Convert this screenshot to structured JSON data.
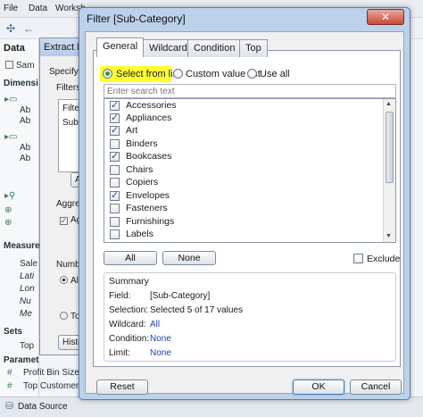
{
  "app": {
    "menu": [
      "File",
      "Data",
      "Worksh"
    ],
    "left_pane": {
      "data_header": "Data",
      "sample_label": "Sam",
      "dimensions_header": "Dimensi",
      "dim_items": [
        "Ab",
        "Ab",
        "Ab",
        "Ab",
        "Ab"
      ],
      "measures_header": "Measure",
      "measure_items": [
        "Sale",
        "Lati",
        "Lon",
        "Nu",
        "Me"
      ],
      "sets_header": "Sets",
      "sets_items": [
        "Top"
      ],
      "params_header": "Paramet",
      "params_items": [
        "Profit Bin Size",
        "Top Customers"
      ]
    },
    "status_bar": "Data Source"
  },
  "extract_dialog": {
    "title": "Extract Da",
    "specify_text": "Specify h",
    "filters_label": "Filters (",
    "filter_col_header": "Filter",
    "filter_row": "Sub-C",
    "add_btn": "Ad",
    "aggregation_label": "Aggrega",
    "agg_check": "Agg",
    "number_label": "Numbe",
    "all_radio": "All",
    "top_radio": "Top",
    "history_btn": "Histor"
  },
  "filter_dialog": {
    "title": "Filter [Sub-Category]",
    "close_glyph": "✕",
    "tabs": [
      {
        "label": "General",
        "active": true
      },
      {
        "label": "Wildcard",
        "active": false
      },
      {
        "label": "Condition",
        "active": false
      },
      {
        "label": "Top",
        "active": false
      }
    ],
    "radio_options": [
      {
        "label": "Select from list",
        "checked": true
      },
      {
        "label": "Custom value list",
        "checked": false
      },
      {
        "label": "Use all",
        "checked": false
      }
    ],
    "search_placeholder": "Enter search text",
    "items": [
      {
        "label": "Accessories",
        "checked": true
      },
      {
        "label": "Appliances",
        "checked": true
      },
      {
        "label": "Art",
        "checked": true
      },
      {
        "label": "Binders",
        "checked": false
      },
      {
        "label": "Bookcases",
        "checked": true
      },
      {
        "label": "Chairs",
        "checked": false
      },
      {
        "label": "Copiers",
        "checked": false
      },
      {
        "label": "Envelopes",
        "checked": true
      },
      {
        "label": "Fasteners",
        "checked": false
      },
      {
        "label": "Furnishings",
        "checked": false
      },
      {
        "label": "Labels",
        "checked": false
      }
    ],
    "all_btn": "All",
    "none_btn": "None",
    "exclude_label": "Exclude",
    "summary": {
      "title": "Summary",
      "field_key": "Field:",
      "field_val": "[Sub-Category]",
      "selection_key": "Selection:",
      "selection_val": "Selected 5 of 17 values",
      "wildcard_key": "Wildcard:",
      "wildcard_val": "All",
      "condition_key": "Condition:",
      "condition_val": "None",
      "limit_key": "Limit:",
      "limit_val": "None"
    },
    "reset_btn": "Reset",
    "ok_btn": "OK",
    "cancel_btn": "Cancel"
  },
  "colors": {
    "highlight": "#ffff33",
    "link": "#1f45b8",
    "close": "#c74a35"
  }
}
